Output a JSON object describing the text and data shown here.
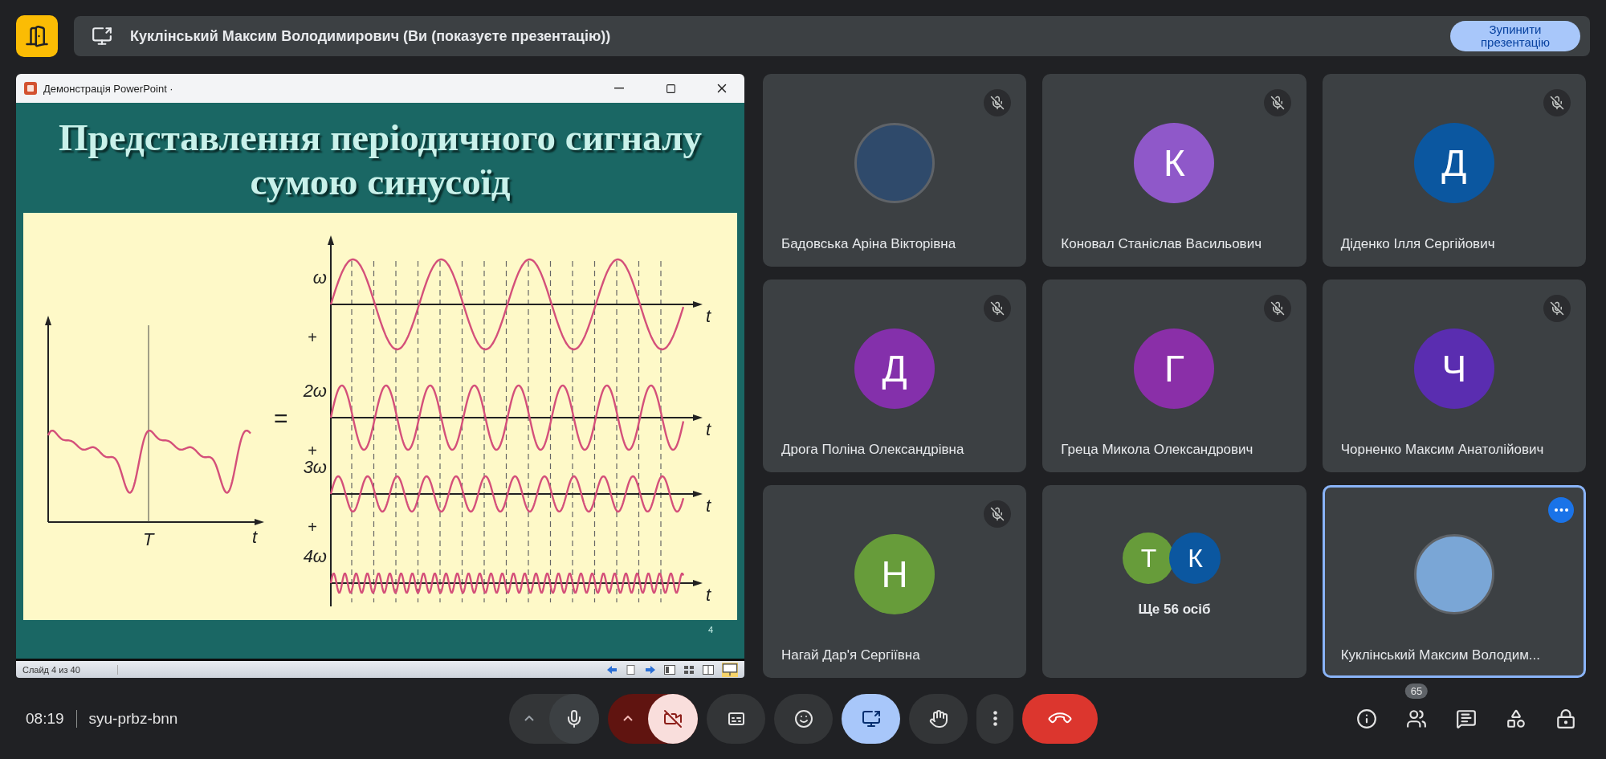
{
  "top_bar": {
    "presenter_text": "Куклінський Максим Володимирович (Ви (показуєте презентацію))",
    "stop_button": "Зупинити презентацію"
  },
  "slide_window": {
    "title": "Демонстрація PowerPoint ·",
    "slide": {
      "title_lines": [
        "Представлення періодичного сигналу",
        "сумою синусоїд"
      ],
      "period_label": "T",
      "time_label": "t",
      "equals": "=",
      "harmonics": [
        {
          "label": "ω",
          "plus": "+",
          "axis_label": "t"
        },
        {
          "label": "2ω",
          "plus": "+",
          "axis_label": "t"
        },
        {
          "label": "3ω",
          "plus": "+",
          "axis_label": "t"
        },
        {
          "label": "4ω",
          "axis_label": "t"
        }
      ],
      "number": "4"
    },
    "status": "Слайд 4 из 40"
  },
  "tiles": [
    {
      "kind": "photo",
      "name": "Бадовська Аріна Вікторівна",
      "muted": true
    },
    {
      "kind": "letter",
      "letter": "К",
      "color": "#8f58c9",
      "name": "Коновал Станіслав Васильович",
      "muted": true
    },
    {
      "kind": "letter",
      "letter": "Д",
      "color": "#0b57a0",
      "name": "Діденко Ілля Сергійович",
      "muted": true
    },
    {
      "kind": "letter",
      "letter": "Д",
      "color": "#8430ab",
      "name": "Дрога Поліна Олександрівна",
      "muted": true
    },
    {
      "kind": "letter",
      "letter": "Г",
      "color": "#8a2fa8",
      "name": "Греца Микола Олександрович",
      "muted": true
    },
    {
      "kind": "letter",
      "letter": "Ч",
      "color": "#5a2db0",
      "name": "Чорненко Максим Анатолійович",
      "muted": true
    },
    {
      "kind": "letter",
      "letter": "Н",
      "color": "#679c3a",
      "name": "Нагай Дар'я Сергіївна",
      "muted": true
    },
    {
      "kind": "group",
      "avatars": [
        {
          "letter": "Т",
          "color": "#679c3a"
        },
        {
          "letter": "К",
          "color": "#0b57a0"
        }
      ],
      "name": "Ще 56 осіб",
      "muted": false
    },
    {
      "kind": "photo",
      "name": "Куклінський Максим Володим...",
      "muted": false,
      "highlighted": true
    }
  ],
  "bottom_bar": {
    "time": "08:19",
    "meeting_code": "syu-prbz-bnn",
    "controls": [
      {
        "kind": "mic",
        "on": true
      },
      {
        "kind": "camera",
        "on": false
      },
      {
        "kind": "captions",
        "on": false
      },
      {
        "kind": "reactions"
      },
      {
        "kind": "present",
        "on": true
      },
      {
        "kind": "hand",
        "on": false
      },
      {
        "kind": "more"
      },
      {
        "kind": "leave"
      }
    ],
    "participant_count": "65"
  }
}
